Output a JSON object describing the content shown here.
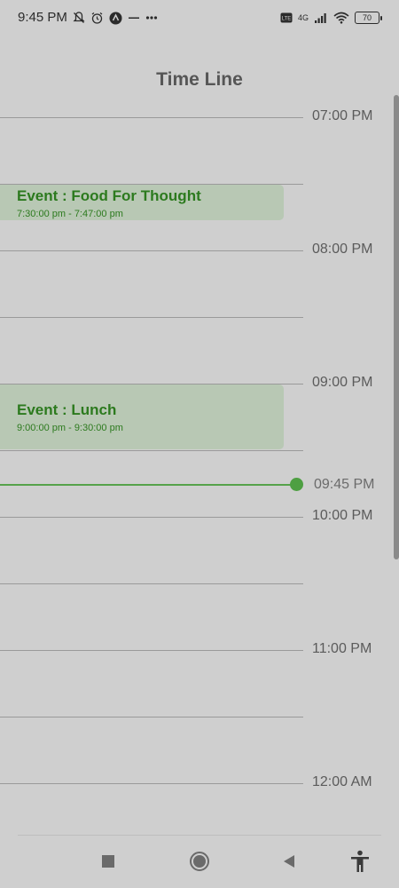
{
  "status_bar": {
    "time": "9:45 PM",
    "network": "4G",
    "volte": "VoLTE",
    "battery": "70",
    "icons": [
      "bell-off-icon",
      "alarm-icon",
      "app-icon",
      "dash-icon",
      "more-dots-icon",
      "volte-icon",
      "signal-icon",
      "wifi-icon",
      "battery-icon"
    ]
  },
  "header": {
    "title": "Time Line"
  },
  "timeline": {
    "hour_labels": [
      "07:00 PM",
      "08:00 PM",
      "09:00 PM",
      "10:00 PM",
      "11:00 PM",
      "12:00 AM"
    ],
    "events": [
      {
        "title": "Event : Food For Thought",
        "time": "7:30:00 pm - 7:47:00 pm"
      },
      {
        "title": "Event : Lunch",
        "time": "9:00:00 pm - 9:30:00 pm"
      }
    ],
    "current_time_label": "09:45 PM",
    "accent_color": "#4e9f42",
    "event_bg_color": "#b8c8b4"
  },
  "nav_bar": {
    "buttons": [
      "recent-apps-icon",
      "home-icon",
      "back-icon",
      "accessibility-icon"
    ]
  }
}
